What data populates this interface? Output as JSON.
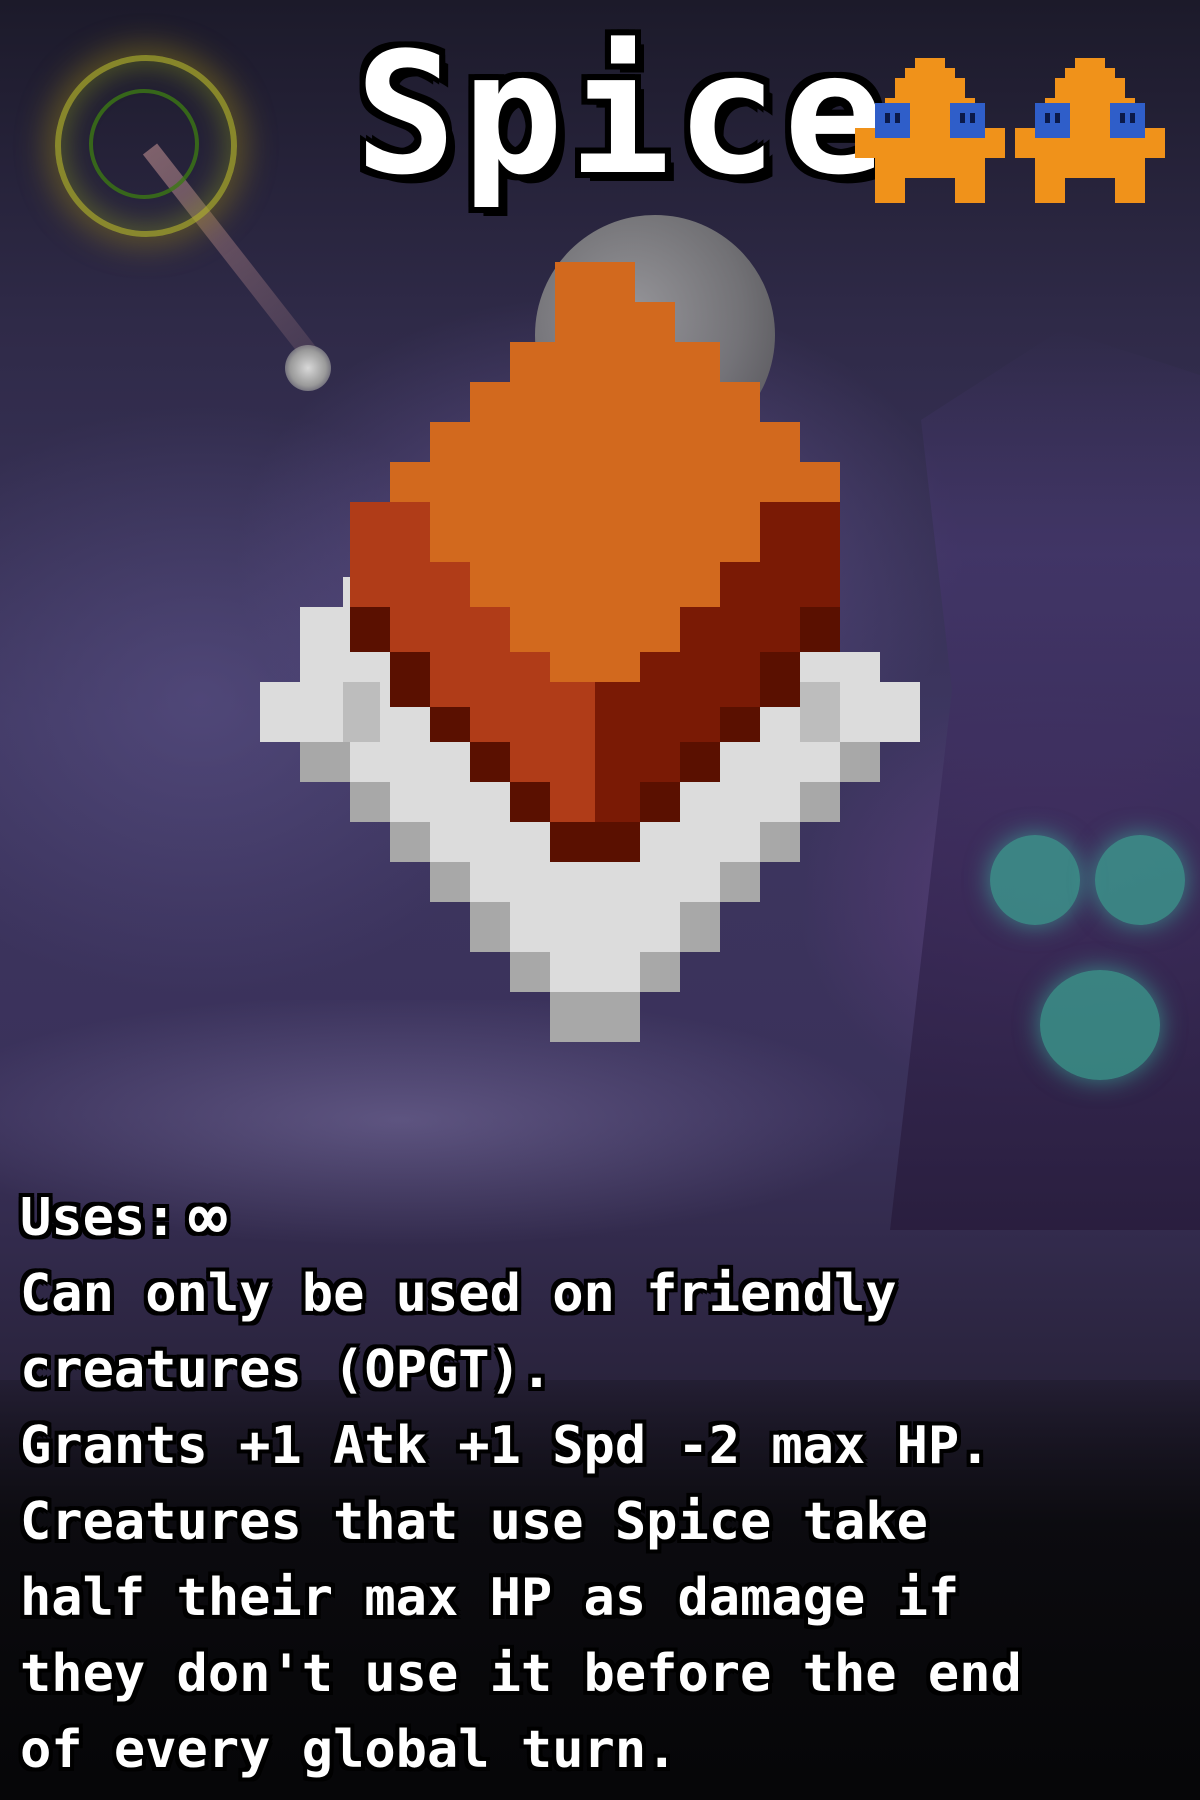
{
  "card": {
    "title": "Spice",
    "cost_icon": "orange-creature-icon",
    "cost_count": 2,
    "art_icon": "spice-packet-icon",
    "uses_label": "Uses:",
    "uses_value": "∞",
    "description_lines": [
      "Can only be used on friendly",
      "creatures (OPGT).",
      "Grants +1 Atk +1 Spd -2 max HP.",
      "Creatures that use Spice take",
      "half their max HP as damage if",
      "they don't use it before the end",
      "of every global turn."
    ]
  },
  "colors": {
    "title_text": "#ffffff",
    "text_outline": "#000000",
    "creature_orange": "#f0921a",
    "creature_eye": "#2f5ec9",
    "spice_orange": "#d2691e",
    "spice_red": "#b03c18",
    "spice_dark_red": "#7a1a05",
    "packet_light": "#dcdcdc",
    "packet_grey": "#a8a8a8"
  }
}
